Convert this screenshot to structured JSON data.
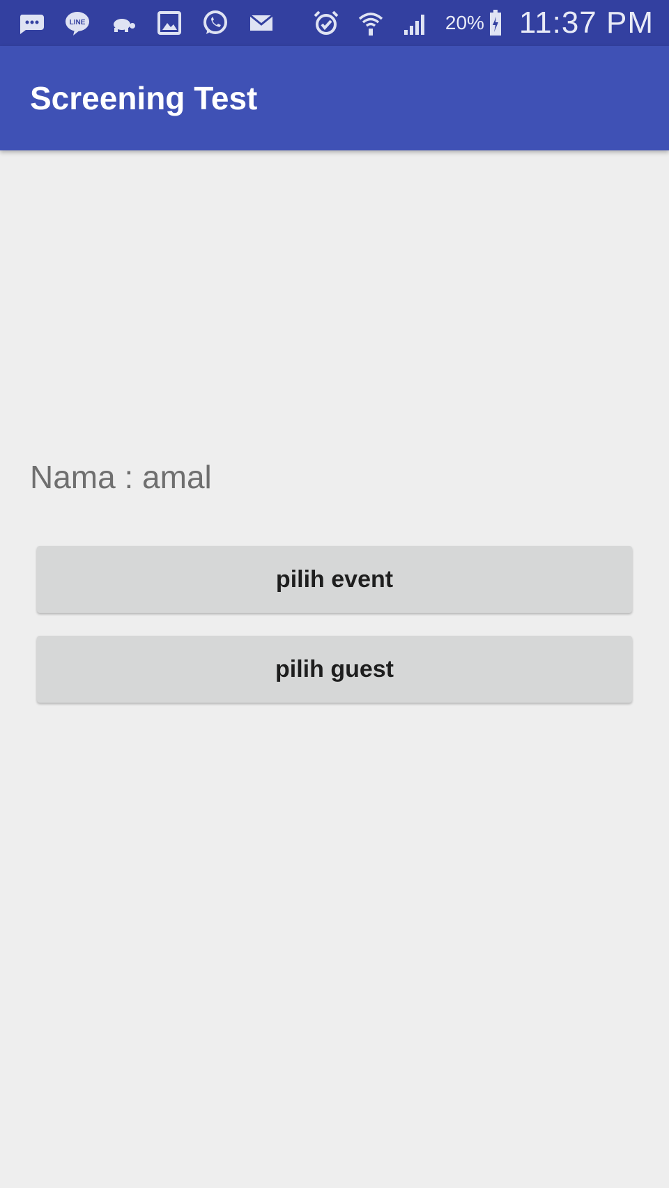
{
  "status_bar": {
    "left_icons": [
      "sms-icon",
      "line-icon",
      "turtle-icon",
      "gallery-icon",
      "whatsapp-icon",
      "email-icon"
    ],
    "right_icons": [
      "alarm-icon",
      "wifi-icon",
      "signal-icon"
    ],
    "battery_percent": "20%",
    "battery_icon": "battery-charging-icon",
    "time": "11:37 PM"
  },
  "app_bar": {
    "title": "Screening Test",
    "color": "#3f51b5"
  },
  "main": {
    "name_label": "Nama : amal",
    "buttons": [
      {
        "label": "pilih event"
      },
      {
        "label": "pilih guest"
      }
    ]
  }
}
